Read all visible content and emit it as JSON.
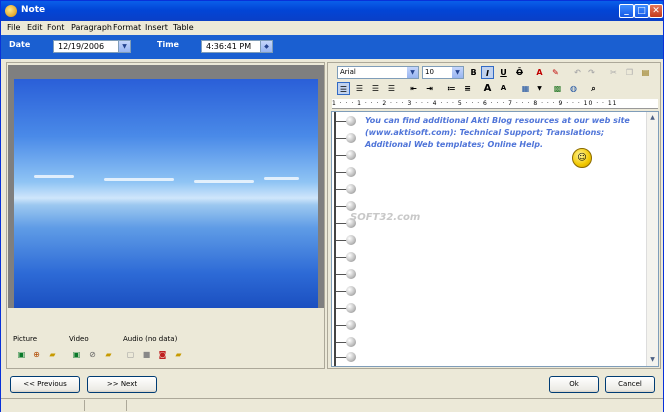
{
  "window": {
    "title": "Note"
  },
  "menu": [
    "File",
    "Edit",
    "Font",
    "Paragraph",
    "Format",
    "Insert",
    "Table"
  ],
  "datebar": {
    "date_label": "Date",
    "date_value": "12/19/2006",
    "time_label": "Time",
    "time_value": "4:36:41 PM"
  },
  "media": {
    "picture_label": "Picture",
    "video_label": "Video",
    "audio_label": "Audio (no data)"
  },
  "editor": {
    "font_name": "Arial",
    "font_size": "10",
    "ruler": "1 · · · 1 · · · 2 · · · 3 · · · 4 · · · 5 · · · 6 · · · 7 · · · 8 · · · 9 · · · 10 · · 11",
    "text": "You can find additional Akti Blog resources at our web site (www.aktisoft.com): Technical Support; Translations; Additional Web templates; Online Help.",
    "watermark": "SOFT32.com"
  },
  "buttons": {
    "previous": "<< Previous",
    "next": ">> Next",
    "ok": "Ok",
    "cancel": "Cancel"
  },
  "colors": {
    "title_bar": "#0245d6",
    "date_bar": "#1a5fd1",
    "note_text": "#4f74d8"
  }
}
